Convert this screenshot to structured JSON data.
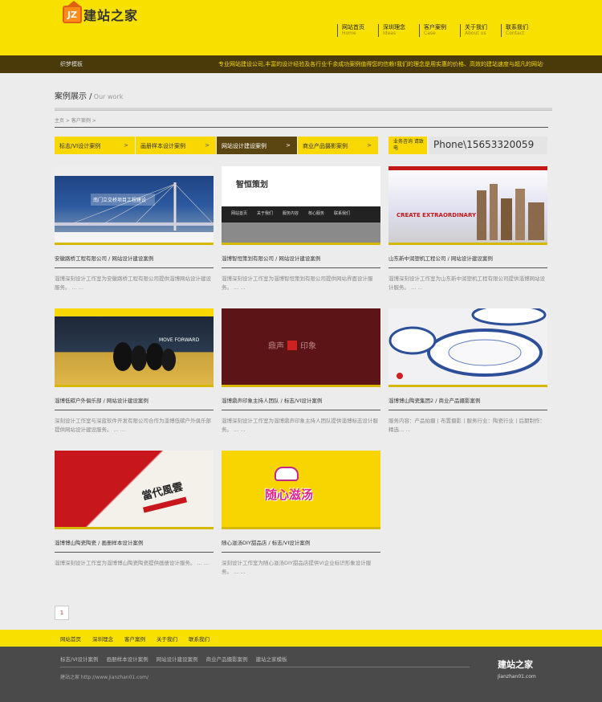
{
  "logo": {
    "badge": "JZ",
    "text": "建站之家"
  },
  "nav": [
    {
      "cn": "网站首页",
      "en": "Home"
    },
    {
      "cn": "深圳理念",
      "en": "Ideas"
    },
    {
      "cn": "客户案例",
      "en": "Case"
    },
    {
      "cn": "关于我们",
      "en": "About us"
    },
    {
      "cn": "联系我们",
      "en": "Contact"
    }
  ],
  "bar": {
    "left": "织梦模板",
    "marquee": "专业网站建设公司,丰富的设计经验及各行业千余成功案例值得您的信赖!我们的理念是用实惠的价格、高效的建站速度与超凡的网站体验"
  },
  "section": {
    "title_cn": "案例展示 /",
    "title_en": "Our work",
    "breadcrumb": "主页 > 客户案例 >"
  },
  "categories": [
    {
      "label": "标志/VI设计案例",
      "arrow": ">"
    },
    {
      "label": "画册样本设计案例",
      "arrow": ">"
    },
    {
      "label": "网站设计建设案例",
      "arrow": ">"
    },
    {
      "label": "商业产品摄影案例",
      "arrow": ">"
    }
  ],
  "contact": {
    "tag": "业务咨询 请致电",
    "phone": "Phone\\15653320059"
  },
  "cases": [
    {
      "title": "安徽路桥工程有限公司 / 网站设计建设案例",
      "desc": "淄博深刻设计工作室为安徽路桥工程有限公司提供淄博网站设计建设服务。 ... ..."
    },
    {
      "title": "淄博智恒策划有限公司 / 网站设计建设案例",
      "desc": "淄博深刻设计工作室为淄博智恒策划有限公司提供网站界面设计服务。 ... ..."
    },
    {
      "title": "山东新中润塑机工程公司 / 网站设计建设案例",
      "desc": "淄博深刻设计工作室为山东新中润塑机工程有限公司提供淄博网站设计服务。 ... ..."
    },
    {
      "title": "淄博低碳户外俱乐部 / 网站设计建设案例",
      "desc": "深刻设计工作室与深蓝软件开发有限公司合作为淄博低碳户外俱乐部提供网站设计建设服务。 ... ..."
    },
    {
      "title": "淄博鼎声印象主持人团队 / 标志/VI设计案例",
      "desc": "淄博深刻设计工作室为淄博鼎声印象主持人团队提供淄博标志设计服务。 ... ..."
    },
    {
      "title": "淄博博山陶瓷集团2 / 商业产品摄影案例",
      "desc": "服务内容：产品拍摄丨布置摄影丨服务行业：陶瓷行业丨后期制作：精选... ..."
    },
    {
      "title": "淄博博山陶瓷陶瓷 / 画册样本设计案例",
      "desc": "淄博深刻设计工作室为淄博博山陶瓷陶瓷提供画册设计服务。 ... ..."
    },
    {
      "title": "随心滋汤DIY甜品店 / 标志/VI设计案例",
      "desc": "深刻设计工作室为随心滋汤DIY甜品店提供VI企业标识形象设计服务。 ... ..."
    }
  ],
  "thumbs": {
    "t1_text": "南门立交桥项目工程建设",
    "t2_brand": "智恒策划",
    "t2_nav": [
      "网站首页",
      "关于我们",
      "服务内容",
      "核心服务",
      "联系我们"
    ],
    "t3_slogan": "CREATE EXTRAORDINARY",
    "t4_text": "MOVE FORWARD",
    "t5_a": "鼎声",
    "t5_b": "印象",
    "t7_title": "當代風雲",
    "t8_text": "随心滋汤"
  },
  "pager": {
    "current": "1"
  },
  "footer_nav": [
    "网站首页",
    "深圳理念",
    "客户案例",
    "关于我们",
    "联系我们"
  ],
  "footer_links": [
    "标志/VI设计案例",
    "画册样本设计案例",
    "网站设计建设案例",
    "商业产品摄影案例",
    "建站之家模板"
  ],
  "footer": {
    "copy": "建站之家 http://www.jianzhan01.com/",
    "brand": "建站之家",
    "domain": "Jianzhan01.com"
  }
}
